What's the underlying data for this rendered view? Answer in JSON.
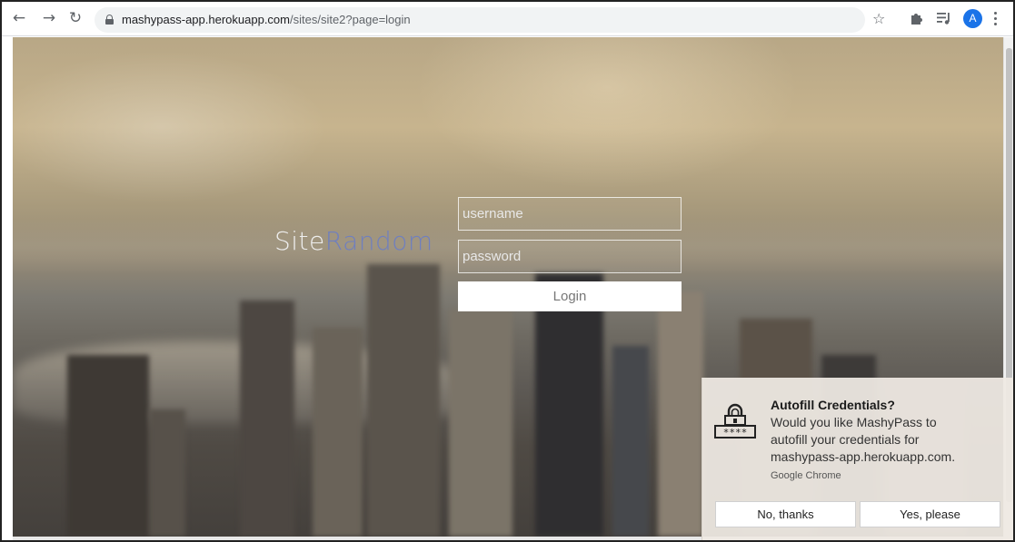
{
  "browser": {
    "url_host": "mashypass-app.herokuapp.com",
    "url_path": "/sites/site2?page=login",
    "profile_initial": "A",
    "icons": {
      "back": "back-arrow-icon",
      "forward": "forward-arrow-icon",
      "reload": "reload-icon",
      "lock": "lock-icon",
      "bookmark": "star-icon",
      "extensions": "puzzle-icon",
      "media": "media-queue-icon",
      "menu": "kebab-menu-icon"
    }
  },
  "login": {
    "brand_prefix": "Site",
    "brand_suffix": "Random",
    "username_placeholder": "username",
    "password_placeholder": "password",
    "login_label": "Login"
  },
  "popup": {
    "title": "Autofill Credentials?",
    "message": "Would you like MashyPass to autofill your credentials for mashypass-app.herokuapp.com.",
    "source": "Google Chrome",
    "decline_label": "No, thanks",
    "accept_label": "Yes, please",
    "icon": "lock-password-icon"
  },
  "colors": {
    "brand_accent": "#6f7fbf",
    "avatar": "#1a73e8"
  }
}
